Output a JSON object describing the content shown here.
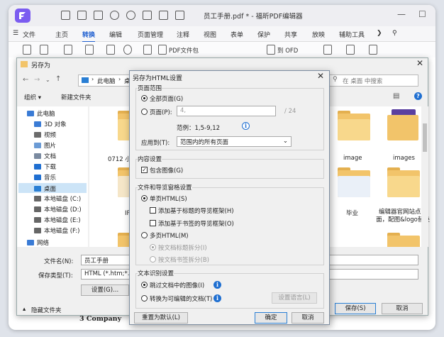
{
  "app": {
    "window_title": "员工手册.pdf * - 福昕PDF编辑器",
    "menu": [
      "文件",
      "主页",
      "转换",
      "编辑",
      "页面管理",
      "注释",
      "视图",
      "表单",
      "保护",
      "共享",
      "放映",
      "辅助工具"
    ],
    "active_menu_index": 2,
    "ribbon_items": [
      "PDF文件包",
      "到 OFD"
    ],
    "doc_text": "3   Company"
  },
  "save_as": {
    "title": "另存为",
    "breadcrumb": [
      "此电脑",
      "桌面"
    ],
    "search_placeholder": "在 桌面 中搜索",
    "organize": "组织 ▾",
    "new_folder": "新建文件夹",
    "nav_items": [
      {
        "label": "此电脑",
        "color": "#3a7bd5"
      },
      {
        "label": "3D 对象",
        "color": "#3a7bd5"
      },
      {
        "label": "视频",
        "color": "#6b6b6b"
      },
      {
        "label": "图片",
        "color": "#6b9bd5"
      },
      {
        "label": "文档",
        "color": "#7a8aa0"
      },
      {
        "label": "下载",
        "color": "#1f6fd1"
      },
      {
        "label": "音乐",
        "color": "#1f6fd1"
      },
      {
        "label": "桌面",
        "color": "#2a7fd4"
      },
      {
        "label": "本地磁盘 (C:)",
        "color": "#666666"
      },
      {
        "label": "本地磁盘 (D:)",
        "color": "#666666"
      },
      {
        "label": "本地磁盘 (E:)",
        "color": "#666666"
      },
      {
        "label": "本地磁盘 (F:)",
        "color": "#666666"
      },
      {
        "label": "网络",
        "color": "#3a7bd5"
      }
    ],
    "selected_nav_index": 7,
    "files": [
      "0712 小",
      "image",
      "images",
      "IP分",
      "毕业",
      "编辑器官网站点页面，配图&logo替换"
    ],
    "filename_label": "文件名(N):",
    "filename_value": "员工手册",
    "filetype_label": "保存类型(T):",
    "filetype_value": "HTML (*.htm;*.html)",
    "settings_button": "设置(G)...",
    "hide_folders": "隐藏文件夹",
    "save_button": "保存(S)",
    "cancel_button": "取消"
  },
  "dialog": {
    "title": "另存为HTML设置",
    "page_range": {
      "group": "页面范围",
      "all_pages": "全部页面(G)",
      "pages": "页面(P):",
      "pages_value": "4,",
      "total": "/ 24",
      "example": "范例：1,5-9,12",
      "apply_to_label": "应用到(T):",
      "apply_to_value": "范围内的所有页面"
    },
    "content": {
      "group": "内容设置",
      "include_images": "包含图像(G)"
    },
    "files_nav": {
      "group": "文件和导览窗格设置",
      "single_page": "单页HTML(S)",
      "add_title_nav": "添加基于标题的导览框架(H)",
      "add_bookmark_nav": "添加基于书签的导览框架(O)",
      "multi_page": "多页HTML(M)",
      "split_by_title": "按文档标题拆分(I)",
      "split_by_bookmark": "按文档书签拆分(B)"
    },
    "ocr": {
      "group": "文本识别设置",
      "skip_images": "跳过文档中的图像(I)",
      "convert_editable": "转换为可编辑的文档(T)",
      "ocr_language_button": "设置语言(L)"
    },
    "reset_button": "重置为默认(L)",
    "ok_button": "确定",
    "cancel_button": "取消"
  }
}
